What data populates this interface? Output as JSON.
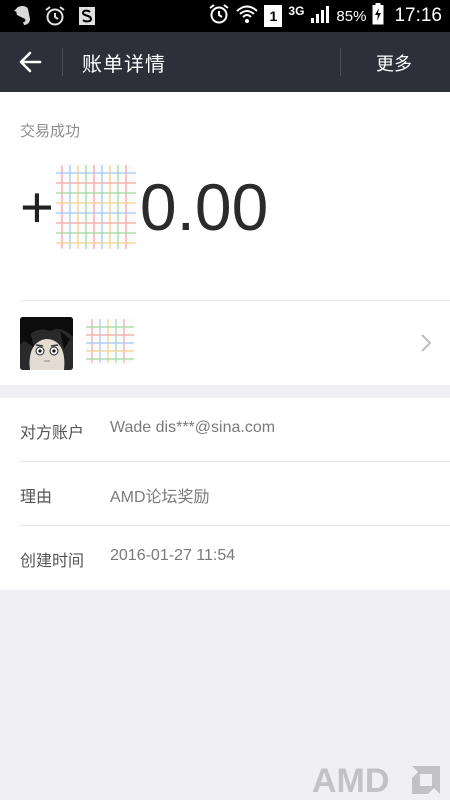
{
  "status_bar": {
    "icons_left": [
      "evernote-icon",
      "alarm-icon",
      "s-app-icon"
    ],
    "network": "3G",
    "sim": "1",
    "battery": "85%",
    "time": "17:16"
  },
  "nav": {
    "title": "账单详情",
    "more_label": "更多"
  },
  "transaction": {
    "status": "交易成功",
    "sign": "+",
    "amount_visible": "0.00"
  },
  "details": [
    {
      "label": "对方账户",
      "value": "Wade dis***@sina.com"
    },
    {
      "label": "理由",
      "value": "AMD论坛奖励"
    },
    {
      "label": "创建时间",
      "value": "2016-01-27 11:54"
    }
  ],
  "watermark": "AMD"
}
